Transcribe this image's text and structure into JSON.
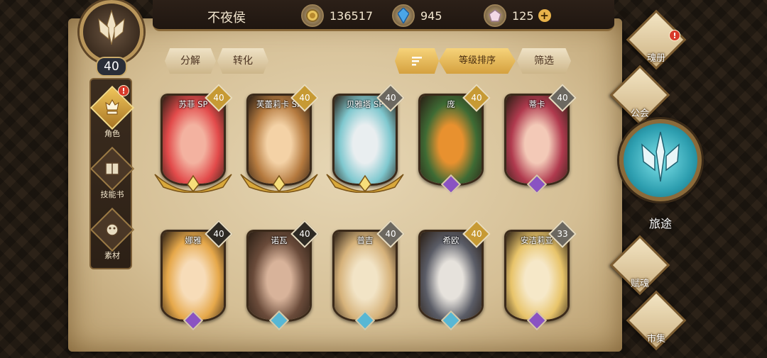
{
  "player": {
    "name": "不夜侯",
    "level": "40"
  },
  "currencies": [
    {
      "icon": "gold-coin-icon",
      "value": "136517"
    },
    {
      "icon": "blue-crystal-icon",
      "value": "945"
    },
    {
      "icon": "gem-icon",
      "value": "125",
      "plus": "+"
    }
  ],
  "left_nav": [
    {
      "label": "角色",
      "active": true,
      "badge": "!"
    },
    {
      "label": "技能书",
      "active": false
    },
    {
      "label": "素材",
      "active": false
    }
  ],
  "actions": {
    "decompose": "分解",
    "convert": "转化",
    "sort_icon": "sort-icon",
    "sort": "等级排序",
    "filter": "筛选"
  },
  "heroes": [
    {
      "name": "苏菲 SP",
      "level": "40",
      "level_style": "gold",
      "frame": "gold"
    },
    {
      "name": "芙蕾莉卡 SP",
      "level": "40",
      "level_style": "gold",
      "frame": "gold"
    },
    {
      "name": "贝雅塔 SP",
      "level": "40",
      "level_style": "grey",
      "frame": "gold"
    },
    {
      "name": "庞",
      "level": "40",
      "level_style": "gold",
      "frame": "purple"
    },
    {
      "name": "蒂卡",
      "level": "40",
      "level_style": "grey",
      "frame": "purple"
    },
    {
      "name": "娜雅",
      "level": "40",
      "level_style": "dark",
      "frame": "purple"
    },
    {
      "name": "诺瓦",
      "level": "40",
      "level_style": "dark",
      "frame": "blue"
    },
    {
      "name": "普吉",
      "level": "40",
      "level_style": "grey",
      "frame": "blue"
    },
    {
      "name": "希欧",
      "level": "40",
      "level_style": "gold",
      "frame": "blue"
    },
    {
      "name": "安洁莉亚",
      "level": "33",
      "level_style": "grey",
      "frame": "purple"
    }
  ],
  "right_nav": [
    {
      "label": "魂册",
      "badge": "!"
    },
    {
      "label": "公会"
    },
    {
      "label": "旅途"
    },
    {
      "label": "赋魂"
    },
    {
      "label": "市集"
    }
  ]
}
